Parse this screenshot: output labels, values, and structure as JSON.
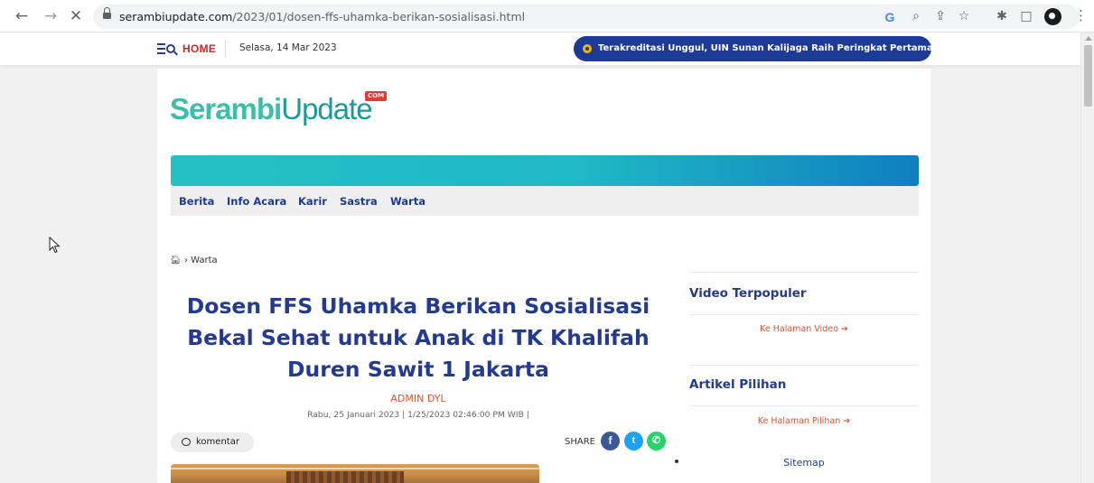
{
  "browser": {
    "url_domain": "serambiupdate.com",
    "url_path": "/2023/01/dosen-ffs-uhamka-berikan-sosialisasi.html",
    "back_icon": "arrow-left-icon",
    "forward_icon": "arrow-right-icon",
    "stop_icon": "close-icon"
  },
  "topbar": {
    "home_label": "HOME",
    "date": "Selasa, 14 Mar 2023",
    "ticker": "Terakreditasi Unggul, UIN Sunan Kalijaga Raih Peringkat Pertama pad..."
  },
  "site": {
    "logo_bold": "Serambi",
    "logo_light": "Update",
    "logo_badge": "COM",
    "menu": [
      "Berita",
      "Info Acara",
      "Karir",
      "Sastra",
      "Warta"
    ]
  },
  "breadcrumb": {
    "separator": "›",
    "current": "Warta"
  },
  "article": {
    "title": "Dosen FFS Uhamka Berikan Sosialisasi Bekal Sehat untuk Anak di TK Khalifah Duren Sawit 1 Jakarta",
    "author": "ADMIN DYL",
    "date_line": "Rabu, 25 Januari 2023 | 1/25/2023 02:46:00 PM WIB |",
    "comment_label": "komentar",
    "share_label": "SHARE"
  },
  "sidebar": {
    "video_heading": "Video Terpopuler",
    "video_link": "Ke Halaman Video ➔",
    "picks_heading": "Artikel Pilihan",
    "picks_link": "Ke Halaman Pilihan ➔",
    "sitemap": "Sitemap"
  },
  "colors": {
    "brand_blue": "#233a8f",
    "accent_orange": "#e0522b",
    "teal": "#23c1c6",
    "facebook": "#3b5998",
    "twitter": "#1da1f2",
    "whatsapp": "#25d366"
  }
}
